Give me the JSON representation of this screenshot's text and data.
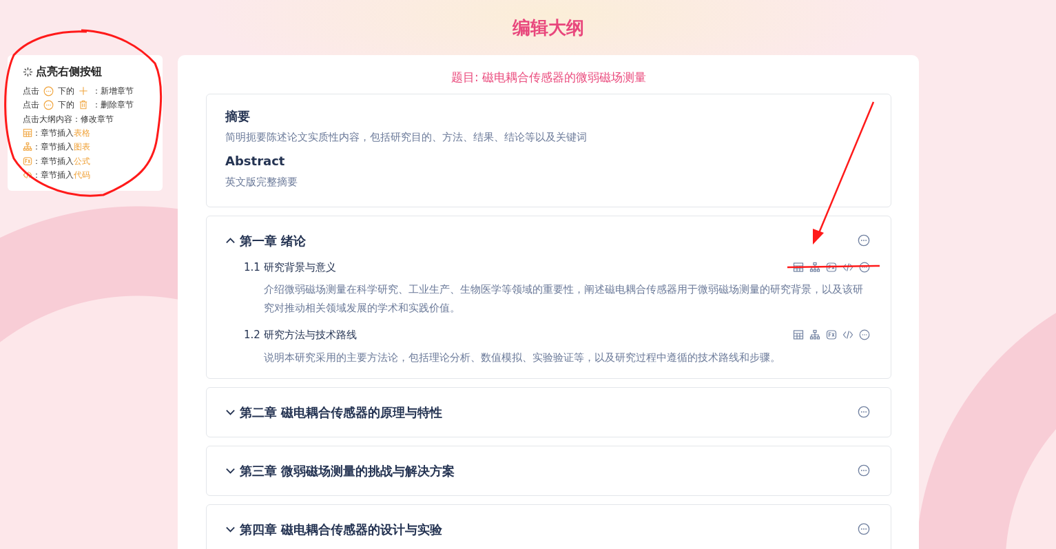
{
  "page_title": "编辑大纲",
  "help": {
    "title": "点亮右侧按钮",
    "lines": [
      {
        "kind": "add",
        "prefix": "点击",
        "middle": "下的",
        "suffix": "：新增章节"
      },
      {
        "kind": "delete",
        "prefix": "点击",
        "middle": "下的",
        "suffix": "：删除章节"
      },
      {
        "kind": "text",
        "text": "点击大纲内容：修改章节"
      },
      {
        "kind": "table",
        "label": "：章节插入",
        "highlight": "表格"
      },
      {
        "kind": "chart",
        "label": "：章节插入",
        "highlight": "图表"
      },
      {
        "kind": "formula",
        "label": "：章节插入",
        "highlight": "公式"
      },
      {
        "kind": "code",
        "label": "：章节插入",
        "highlight": "代码"
      }
    ]
  },
  "topic": "题目: 磁电耦合传感器的微弱磁场测量",
  "abstract": [
    {
      "heading": "摘要",
      "text": "简明扼要陈述论文实质性内容，包括研究目的、方法、结果、结论等以及关键词"
    },
    {
      "heading": "Abstract",
      "text": "英文版完整摘要"
    }
  ],
  "chapters": [
    {
      "title": "第一章 绪论",
      "expanded": true,
      "sections": [
        {
          "number": "1.1",
          "title": "研究背景与意义",
          "text": "介绍微弱磁场测量在科学研究、工业生产、生物医学等领域的重要性，阐述磁电耦合传感器用于微弱磁场测量的研究背景，以及该研究对推动相关领域发展的学术和实践价值。"
        },
        {
          "number": "1.2",
          "title": "研究方法与技术路线",
          "text": "说明本研究采用的主要方法论，包括理论分析、数值模拟、实验验证等，以及研究过程中遵循的技术路线和步骤。"
        }
      ]
    },
    {
      "title": "第二章 磁电耦合传感器的原理与特性",
      "expanded": false
    },
    {
      "title": "第三章 微弱磁场测量的挑战与解决方案",
      "expanded": false
    },
    {
      "title": "第四章 磁电耦合传感器的设计与实验",
      "expanded": false
    }
  ]
}
